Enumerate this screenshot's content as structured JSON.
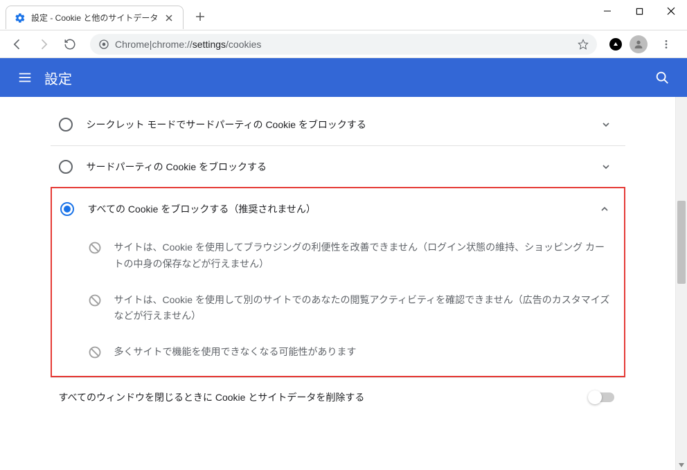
{
  "browser": {
    "tab_title": "設定 - Cookie と他のサイトデータ",
    "url_prefix": "Chrome",
    "url_sep": " | ",
    "url_scheme": "chrome://",
    "url_path_bold": "settings",
    "url_path_rest": "/cookies"
  },
  "header": {
    "title": "設定"
  },
  "options": {
    "opt1": "シークレット モードでサードパーティの Cookie をブロックする",
    "opt2": "サードパーティの Cookie をブロックする",
    "opt3": "すべての Cookie をブロックする（推奨されません）",
    "details": {
      "d1": "サイトは、Cookie を使用してブラウジングの利便性を改善できません（ログイン状態の維持、ショッピング カートの中身の保存などが行えません）",
      "d2": "サイトは、Cookie を使用して別のサイトでのあなたの閲覧アクティビティを確認できません（広告のカスタマイズなどが行えません）",
      "d3": "多くサイトで機能を使用できなくなる可能性があります"
    }
  },
  "toggle": {
    "label": "すべてのウィンドウを閉じるときに Cookie とサイトデータを削除する"
  }
}
